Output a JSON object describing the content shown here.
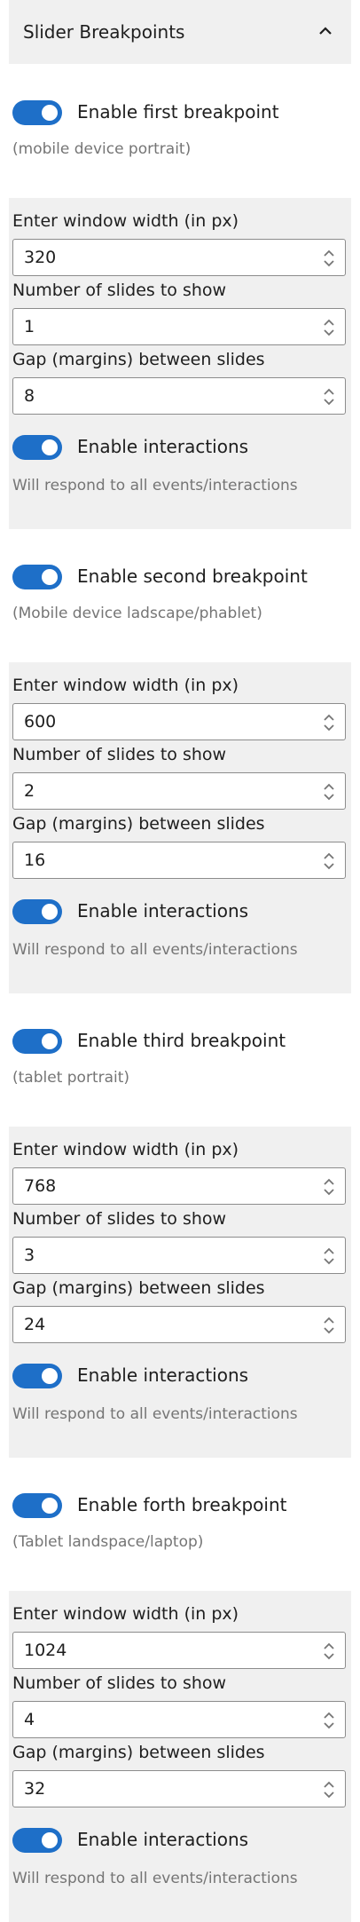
{
  "header": {
    "title": "Slider Breakpoints",
    "chevron_icon": "chevron-up-icon"
  },
  "breakpoints": [
    {
      "toggle_label": "Enable first breakpoint",
      "help": "(mobile device portrait)",
      "width_label": "Enter window width (in px)",
      "width_value": "320",
      "slides_label": "Number of slides to show",
      "slides_value": "1",
      "gap_label": "Gap (margins) between slides",
      "gap_value": "8",
      "interactions_label": "Enable interactions",
      "interactions_help": "Will respond to all events/interactions"
    },
    {
      "toggle_label": "Enable second breakpoint",
      "help": "(Mobile device ladscape/phablet)",
      "width_label": "Enter window width (in px)",
      "width_value": "600",
      "slides_label": "Number of slides to show",
      "slides_value": "2",
      "gap_label": "Gap (margins) between slides",
      "gap_value": "16",
      "interactions_label": "Enable interactions",
      "interactions_help": "Will respond to all events/interactions"
    },
    {
      "toggle_label": "Enable third breakpoint",
      "help": "(tablet portrait)",
      "width_label": "Enter window width (in px)",
      "width_value": "768",
      "slides_label": "Number of slides to show",
      "slides_value": "3",
      "gap_label": "Gap (margins) between slides",
      "gap_value": "24",
      "interactions_label": "Enable interactions",
      "interactions_help": "Will respond to all events/interactions"
    },
    {
      "toggle_label": "Enable forth breakpoint",
      "help": "(Tablet landspace/laptop)",
      "width_label": "Enter window width (in px)",
      "width_value": "1024",
      "slides_label": "Number of slides to show",
      "slides_value": "4",
      "gap_label": "Gap (margins) between slides",
      "gap_value": "32",
      "interactions_label": "Enable interactions",
      "interactions_help": "Will respond to all events/interactions"
    }
  ],
  "colors": {
    "accent": "#1e6fc8",
    "panel": "#f0f0f0",
    "help_text": "#757575"
  }
}
